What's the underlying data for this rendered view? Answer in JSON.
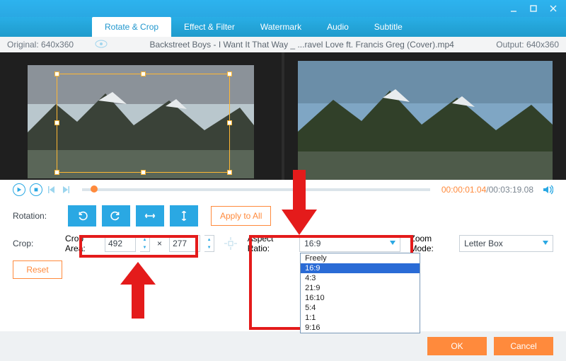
{
  "window": {
    "app": "video-editor"
  },
  "tabs": {
    "items": [
      {
        "label": "Rotate & Crop",
        "id": "rotate-crop",
        "active": true
      },
      {
        "label": "Effect & Filter",
        "id": "effect-filter"
      },
      {
        "label": "Watermark",
        "id": "watermark"
      },
      {
        "label": "Audio",
        "id": "audio"
      },
      {
        "label": "Subtitle",
        "id": "subtitle"
      }
    ]
  },
  "infobar": {
    "original_label": "Original: 640x360",
    "file_title": "Backstreet Boys - I Want It That Way _ ...ravel Love ft. Francis Greg (Cover).mp4",
    "output_label": "Output: 640x360"
  },
  "playbar": {
    "current": "00:00:01.04",
    "sep": "/",
    "total": "00:03:19.08"
  },
  "rotation": {
    "label": "Rotation:",
    "apply_label": "Apply to All"
  },
  "crop": {
    "label": "Crop:",
    "area_label": "Crop Area:",
    "w": "492",
    "h": "277",
    "x_sep": "×",
    "reset_label": "Reset"
  },
  "aspect": {
    "label": "Aspect Ratio:",
    "value": "16:9",
    "options": [
      "Freely",
      "16:9",
      "4:3",
      "21:9",
      "16:10",
      "5:4",
      "1:1",
      "9:16"
    ]
  },
  "zoom": {
    "label": "Zoom Mode:",
    "value": "Letter Box"
  },
  "footer": {
    "ok": "OK",
    "cancel": "Cancel"
  }
}
